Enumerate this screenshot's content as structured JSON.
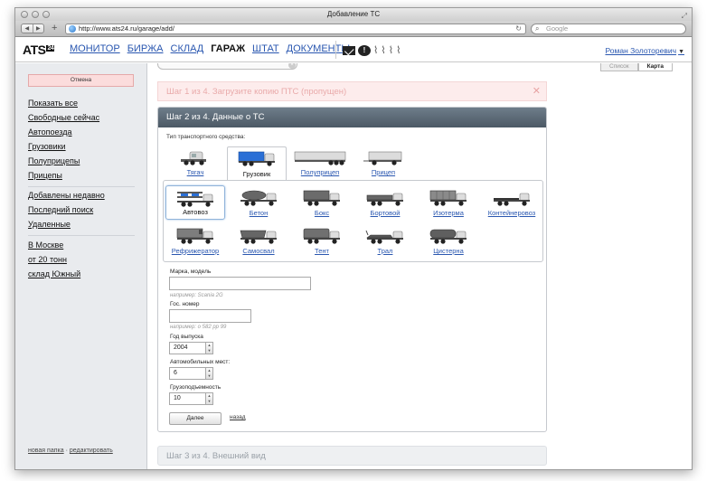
{
  "browser": {
    "window_title": "Добавление ТС",
    "url": "http://www.ats24.ru/garage/add/",
    "search_placeholder": "Google"
  },
  "app": {
    "logo": "ATS",
    "logo_badge": "24",
    "nav": [
      {
        "label": "МОНИТОР",
        "active": false
      },
      {
        "label": "БИРЖА",
        "active": false
      },
      {
        "label": "СКЛАД",
        "active": false
      },
      {
        "label": "ГАРАЖ",
        "active": true
      },
      {
        "label": "ШТАТ",
        "active": false
      },
      {
        "label": "ДОКУМЕНТЫ",
        "active": false
      }
    ],
    "alert_glyph": "!",
    "user": "Роман Золоторевич"
  },
  "sidebar": {
    "cancel": "Отмена",
    "group1": [
      "Показать все",
      "Свободные сейчас",
      "Автопоезда",
      "Грузовики",
      "Полуприцепы",
      "Прицепы"
    ],
    "group2": [
      "Добавлены недавно",
      "Последний поиск",
      "Удаленные"
    ],
    "group3": [
      "В Москве",
      "от 20 тонн",
      "склад Южный"
    ],
    "footer_new_folder": "новая папка",
    "footer_separator": "·",
    "footer_edit": "редактировать"
  },
  "view_tabs": {
    "list": "Список",
    "map": "Карта"
  },
  "steps": {
    "step1": "Шаг 1 из 4. Загрузите копию ПТС (пропущен)",
    "step2": "Шаг 2 из 4. Данные о ТС",
    "step3": "Шаг 3 из 4. Внешний вид"
  },
  "form": {
    "vehicle_type_label": "Тип транспортного средства:",
    "vehicle_types": [
      "Тягач",
      "Грузовик",
      "Полуприцеп",
      "Прицеп"
    ],
    "selected_vehicle_type": "Грузовик",
    "body_types": [
      "Автовоз",
      "Бетон",
      "Бокс",
      "Бортовой",
      "Изотерма",
      "Контейнеровоз",
      "Рефрижератор",
      "Самосвал",
      "Тент",
      "Трал",
      "Цистерна"
    ],
    "selected_body_type": "Автовоз",
    "make_label": "Марка, модель",
    "make_value": "",
    "make_hint": "например: Scania 2G",
    "plate_label": "Гос. номер",
    "plate_value": "",
    "plate_hint": "например: о 582 рр 99",
    "year_label": "Год выпуска",
    "year_value": "2004",
    "car_slots_label": "Автомобильных мест:",
    "car_slots_value": "6",
    "capacity_label": "Грузоподъемность",
    "capacity_value": "10",
    "next_button": "Далее",
    "back_link": "назад"
  },
  "colors": {
    "link": "#2a57b0",
    "card_header": "#5a6773",
    "cabin_blue": "#2a6fd6",
    "cancel_bg": "#fbdcdc"
  }
}
